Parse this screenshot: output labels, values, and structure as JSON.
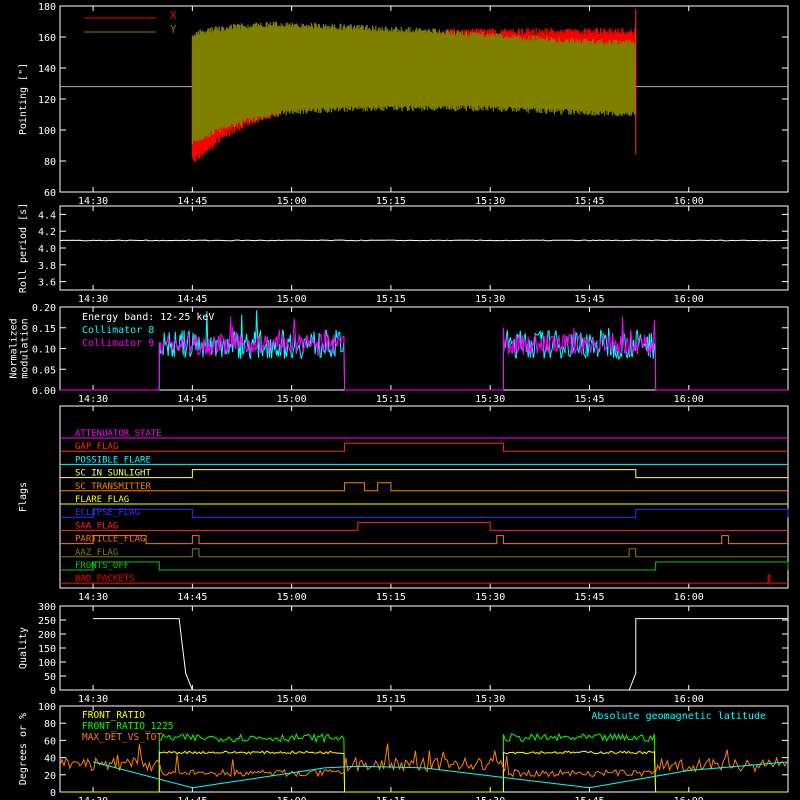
{
  "colors": {
    "background": "#000000",
    "axis": "#ffffff",
    "x": "#ff0000",
    "y": "#808000",
    "cyan": "#00ffff",
    "magenta": "#ff00ff",
    "green": "#00ff00",
    "yellow": "#ffff00",
    "orange": "#ff8000",
    "blue": "#0000ff"
  },
  "time_ticks": [
    "14:30",
    "14:45",
    "15:00",
    "15:15",
    "15:30",
    "15:45",
    "16:00"
  ],
  "chart_data": [
    {
      "id": "pointing",
      "type": "line",
      "ylabel": "Pointing [\"]",
      "ylim": [
        60,
        180
      ],
      "yticks": [
        "60",
        "80",
        "100",
        "120",
        "140",
        "160",
        "180"
      ],
      "series": [
        {
          "name": "X",
          "color": "#ff0000"
        },
        {
          "name": "Y",
          "color": "#808000"
        }
      ],
      "data_window": [
        "14:45",
        "15:52"
      ],
      "x_envelope": {
        "t": [
          "14:45",
          "14:46",
          "14:50",
          "14:55",
          "15:00",
          "15:10",
          "15:20",
          "15:30",
          "15:40",
          "15:52"
        ],
        "upper": [
          150,
          140,
          152,
          158,
          160,
          162,
          165,
          166,
          166,
          166
        ],
        "lower": [
          78,
          80,
          95,
          105,
          112,
          115,
          118,
          119,
          118,
          118
        ]
      },
      "y_envelope": {
        "t": [
          "14:45",
          "14:46",
          "14:50",
          "14:55",
          "15:00",
          "15:10",
          "15:20",
          "15:30",
          "15:40",
          "15:52"
        ],
        "upper": [
          162,
          165,
          168,
          170,
          170,
          168,
          166,
          163,
          160,
          158
        ],
        "lower": [
          90,
          92,
          100,
          106,
          110,
          112,
          112,
          112,
          110,
          108
        ]
      },
      "reference_line": 128
    },
    {
      "id": "roll",
      "type": "line",
      "ylabel": "Roll period [s]",
      "ylim": [
        3.5,
        4.5
      ],
      "yticks": [
        "3.6",
        "3.8",
        "4.0",
        "4.2",
        "4.4"
      ],
      "series": [
        {
          "name": "roll period",
          "color": "#ffffff",
          "value": 4.09
        }
      ]
    },
    {
      "id": "modulation",
      "type": "line",
      "ylabel": "Normalized\nmodulation",
      "ylim": [
        0,
        0.2
      ],
      "yticks": [
        "0.00",
        "0.05",
        "0.10",
        "0.15",
        "0.20"
      ],
      "legend": {
        "title": "Energy band: 12-25 keV",
        "items": [
          {
            "name": "Collimator 8",
            "color": "#00ffff"
          },
          {
            "name": "Collimator 9",
            "color": "#ff00ff"
          }
        ]
      },
      "active_intervals": [
        [
          "14:40",
          "15:08"
        ],
        [
          "15:32",
          "15:55"
        ]
      ],
      "mean": 0.11
    },
    {
      "id": "flags",
      "type": "line",
      "ylabel": "Flags",
      "flags": [
        {
          "name": "ATTENUATOR_STATE",
          "color": "#ff00ff",
          "high": []
        },
        {
          "name": "GAP_FLAG",
          "color": "#ff3300",
          "high": [
            [
              "15:08",
              "15:32"
            ]
          ]
        },
        {
          "name": "POSSIBLE_FLARE",
          "color": "#00ffff",
          "high": []
        },
        {
          "name": "SC_IN_SUNLIGHT",
          "color": "#ffff66",
          "high": [
            [
              "14:45",
              "15:52"
            ]
          ]
        },
        {
          "name": "SC_TRANSMITTER",
          "color": "#ff8000",
          "high": [
            [
              "15:08",
              "15:11"
            ],
            [
              "15:13",
              "15:15"
            ]
          ]
        },
        {
          "name": "FLARE_FLAG",
          "color": "#ffff00",
          "high": []
        },
        {
          "name": "ECLIPSE_FLAG",
          "color": "#3333ff",
          "high": [
            [
              "14:30",
              "14:45"
            ],
            [
              "15:52",
              "16:15"
            ]
          ]
        },
        {
          "name": "SAA_FLAG",
          "color": "#ff2020",
          "high": [
            [
              "15:10",
              "15:30"
            ]
          ]
        },
        {
          "name": "PARTICLE_FLAG",
          "color": "#ff7700",
          "high": [
            [
              "14:30",
              "14:38"
            ],
            [
              "14:45",
              "14:46"
            ],
            [
              "15:31",
              "15:32"
            ],
            [
              "16:05",
              "16:06"
            ]
          ]
        },
        {
          "name": "AAZ_FLAG",
          "color": "#808000",
          "high": [
            [
              "14:45",
              "14:46"
            ],
            [
              "15:51",
              "15:52"
            ]
          ]
        },
        {
          "name": "FRONTS_OFF",
          "color": "#00cc00",
          "high": [
            [
              "14:30",
              "14:40"
            ],
            [
              "15:55",
              "16:15"
            ]
          ]
        },
        {
          "name": "BAD_PACKETS",
          "color": "#ff0000",
          "high": [
            [
              "16:12",
              "16:12"
            ]
          ]
        }
      ]
    },
    {
      "id": "quality",
      "type": "line",
      "ylabel": "Quality",
      "ylim": [
        0,
        300
      ],
      "yticks": [
        "0",
        "50",
        "100",
        "150",
        "200",
        "250",
        "300"
      ],
      "series": [
        {
          "name": "quality",
          "color": "#ffffff",
          "points": [
            [
              "14:30",
              255
            ],
            [
              "14:43",
              255
            ],
            [
              "14:44",
              60
            ],
            [
              "14:45",
              0
            ],
            [
              "15:51",
              0
            ],
            [
              "15:52",
              60
            ],
            [
              "15:52",
              255
            ],
            [
              "16:15",
              255
            ]
          ]
        }
      ]
    },
    {
      "id": "ratios",
      "type": "line",
      "ylabel": "Degrees or %",
      "ylim": [
        0,
        100
      ],
      "yticks": [
        "0",
        "20",
        "40",
        "60",
        "80",
        "100"
      ],
      "series": [
        {
          "name": "FRONT_RATIO",
          "color": "#ffff00"
        },
        {
          "name": "FRONT_RATIO_1225",
          "color": "#00ff00"
        },
        {
          "name": "MAX_DET_VS_TOT",
          "color": "#ff8000"
        },
        {
          "name": "Absolute geomagnetic latitude",
          "color": "#00ffff"
        }
      ],
      "front_ratio": {
        "active": [
          [
            "14:40",
            "15:08"
          ],
          [
            "15:32",
            "15:55"
          ]
        ],
        "value": 46
      },
      "front_ratio_1225": {
        "active": [
          [
            "14:40",
            "15:08"
          ],
          [
            "15:32",
            "15:55"
          ]
        ],
        "value": 63
      },
      "max_det_vs_tot": {
        "value": 22,
        "off_value": 32
      },
      "geomag_lat": {
        "points": [
          [
            "14:30",
            35
          ],
          [
            "14:45",
            5
          ],
          [
            "15:05",
            28
          ],
          [
            "15:10",
            30
          ],
          [
            "15:20",
            28
          ],
          [
            "15:45",
            5
          ],
          [
            "16:00",
            25
          ],
          [
            "16:15",
            35
          ]
        ]
      }
    }
  ]
}
